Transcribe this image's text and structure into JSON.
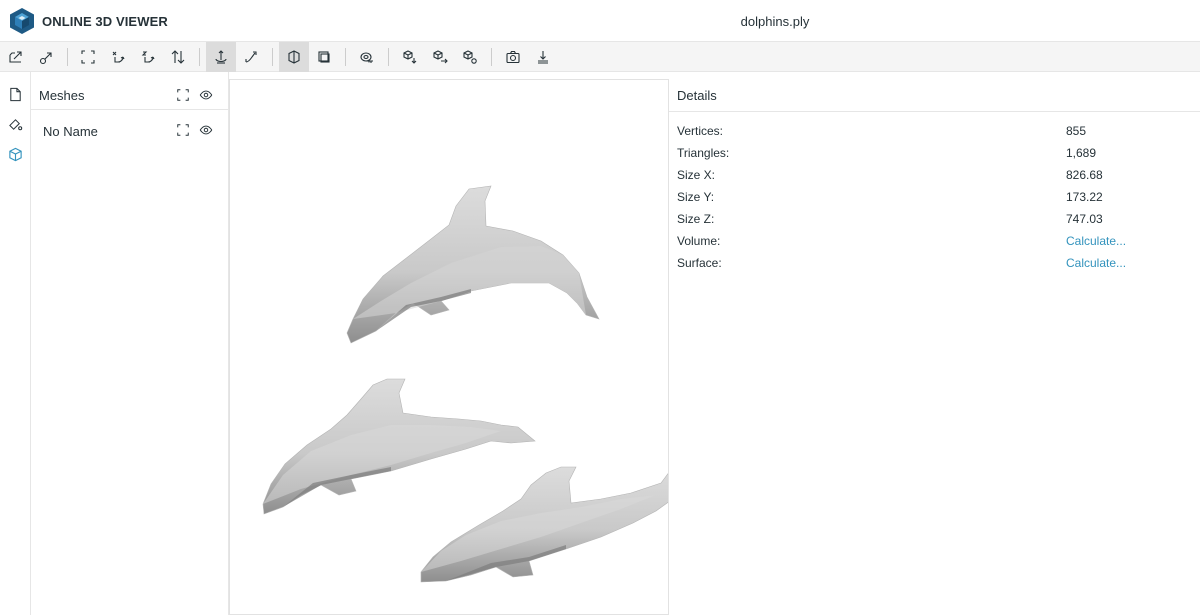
{
  "app": {
    "title": "ONLINE 3D VIEWER",
    "file_name": "dolphins.ply"
  },
  "toolbar": {
    "buttons": [
      {
        "name": "open-file-button",
        "icon": "open-file-icon"
      },
      {
        "name": "open-url-button",
        "icon": "open-url-icon"
      },
      {
        "name": "fit-to-window-button",
        "icon": "fit-icon"
      },
      {
        "name": "set-up-y-button",
        "icon": "up-y-icon"
      },
      {
        "name": "set-up-z-button",
        "icon": "up-z-icon"
      },
      {
        "name": "flip-up-button",
        "icon": "flip-icon"
      },
      {
        "name": "fixed-up-vector-button",
        "icon": "fix-up-on-icon",
        "selected": true
      },
      {
        "name": "free-orbit-button",
        "icon": "fix-up-off-icon"
      },
      {
        "name": "perspective-camera-button",
        "icon": "camera-perspective-icon",
        "selected": true
      },
      {
        "name": "orthographic-camera-button",
        "icon": "camera-orthographic-icon"
      },
      {
        "name": "measure-button",
        "icon": "measure-icon"
      },
      {
        "name": "export-button",
        "icon": "export-icon"
      },
      {
        "name": "share-button",
        "icon": "share-icon"
      },
      {
        "name": "embed-button",
        "icon": "embed-icon"
      },
      {
        "name": "snapshot-button",
        "icon": "camera-icon"
      },
      {
        "name": "settings-button",
        "icon": "settings-icon"
      }
    ]
  },
  "nav": [
    "files-icon",
    "materials-icon",
    "meshes-icon"
  ],
  "meshes_panel": {
    "title": "Meshes",
    "items": [
      {
        "label": "No Name"
      }
    ]
  },
  "details": {
    "title": "Details",
    "rows": [
      {
        "label": "Vertices:",
        "value": "855"
      },
      {
        "label": "Triangles:",
        "value": "1,689"
      },
      {
        "label": "Size X:",
        "value": "826.68"
      },
      {
        "label": "Size Y:",
        "value": "173.22"
      },
      {
        "label": "Size Z:",
        "value": "747.03"
      },
      {
        "label": "Volume:",
        "value": "Calculate..."
      },
      {
        "label": "Surface:",
        "value": "Calculate..."
      }
    ]
  },
  "colors": {
    "accent": "#3393bd",
    "logo": "#1e5a85",
    "model": "#c8c8c8"
  }
}
